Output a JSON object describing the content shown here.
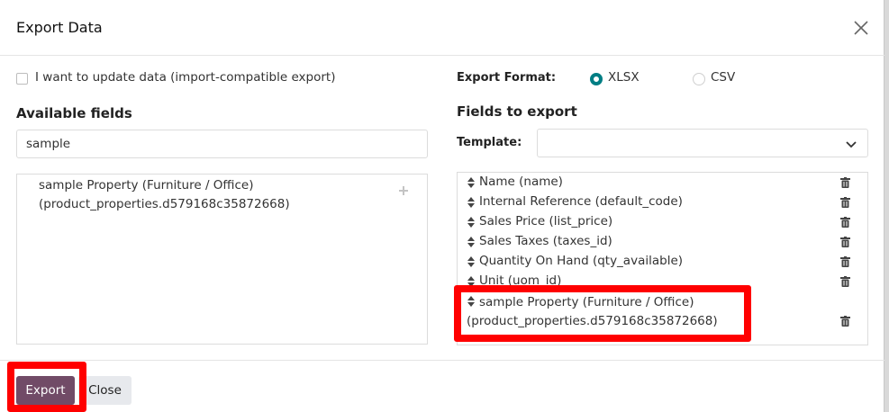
{
  "dialog": {
    "title": "Export Data"
  },
  "left": {
    "checkbox_label": "I want to update data (import-compatible export)",
    "available_title": "Available fields",
    "search_value": "sample",
    "available_item_line1": "sample Property (Furniture / Office)",
    "available_item_line2": "(product_properties.d579168c35872668)"
  },
  "right": {
    "format_label": "Export Format:",
    "format_options": [
      "XLSX",
      "CSV"
    ],
    "format_selected": "XLSX",
    "fields_title": "Fields to export",
    "template_label": "Template:",
    "template_value": "",
    "fields": [
      "Name (name)",
      "Internal Reference (default_code)",
      "Sales Price (list_price)",
      "Sales Taxes (taxes_id)",
      "Quantity On Hand (qty_available)",
      "Unit (uom_id)"
    ],
    "last_field_line1": "sample Property (Furniture / Office)",
    "last_field_line2": "(product_properties.d579168c35872668)"
  },
  "footer": {
    "export_label": "Export",
    "close_label": "Close"
  },
  "colors": {
    "primary": "#714b67",
    "radio_accent": "#017e84",
    "highlight": "#ff0000"
  }
}
